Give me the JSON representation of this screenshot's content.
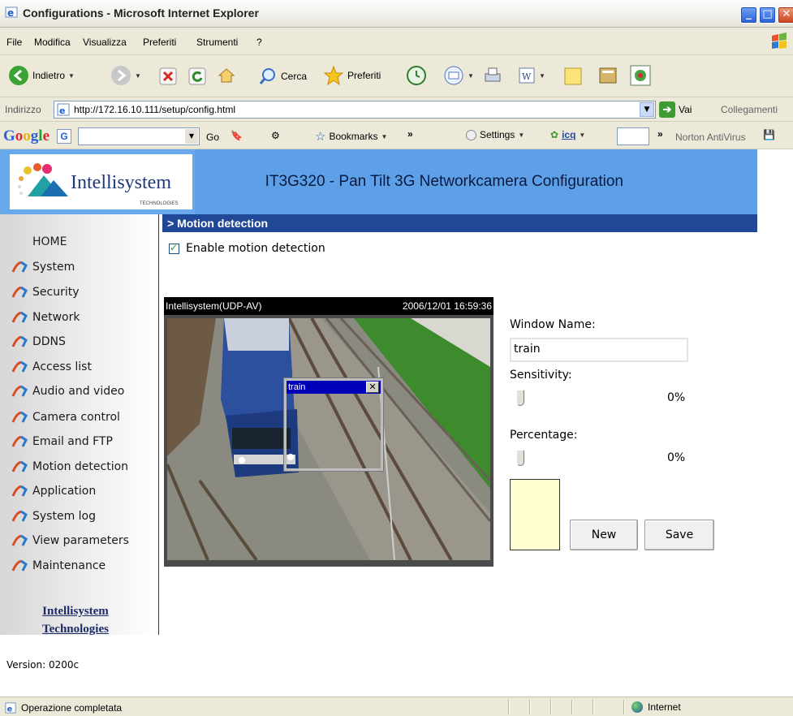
{
  "window": {
    "title": "Configurations - Microsoft Internet Explorer",
    "min_label": "_",
    "max_label": "□",
    "close_label": "✕"
  },
  "menu": [
    "File",
    "Modifica",
    "Visualizza",
    "Preferiti",
    "Strumenti",
    "?"
  ],
  "toolbar": {
    "back": "Indietro",
    "search": "Cerca",
    "favorites": "Preferiti"
  },
  "address": {
    "label": "Indirizzo",
    "url": "http://172.16.10.111/setup/config.html",
    "go": "Vai",
    "links": "Collegamenti"
  },
  "googlebar": {
    "logo": "Google",
    "go": "Go",
    "bookmarks": "Bookmarks",
    "settings": "Settings",
    "icq": "icq",
    "norton": "Norton AntiVirus",
    "more": "»"
  },
  "header": {
    "title": "IT3G320 - Pan Tilt 3G Networkcamera Configuration",
    "logo": "Intellisystem",
    "logo_sub": "TECHNOLOGIES"
  },
  "sidebar": {
    "home": "HOME",
    "items": [
      {
        "label": "System"
      },
      {
        "label": "Security"
      },
      {
        "label": "Network"
      },
      {
        "label": "DDNS"
      },
      {
        "label": "Access list"
      },
      {
        "label": "Audio and video"
      },
      {
        "label": "Camera control"
      },
      {
        "label": "Email and FTP"
      },
      {
        "label": "Motion detection"
      },
      {
        "label": "Application"
      },
      {
        "label": "System log"
      },
      {
        "label": "View parameters"
      },
      {
        "label": "Maintenance"
      }
    ],
    "company_line1": "Intellisystem",
    "company_line2": "Technologies",
    "version": "Version: 0200c"
  },
  "section": {
    "title": "> Motion detection"
  },
  "motion": {
    "enable_label": "Enable motion detection",
    "enabled": true,
    "camera_name": "Intellisystem(UDP-AV)",
    "camera_time": "2006/12/01 16:59:36",
    "window_title": "train",
    "window_close": "✕",
    "window_name_label": "Window Name:",
    "window_name_value": "train",
    "sensitivity_label": "Sensitivity:",
    "sensitivity_value": "0%",
    "percentage_label": "Percentage:",
    "percentage_value": "0%",
    "new_button": "New",
    "save_button": "Save"
  },
  "status": {
    "text": "Operazione completata",
    "zone": "Internet"
  }
}
